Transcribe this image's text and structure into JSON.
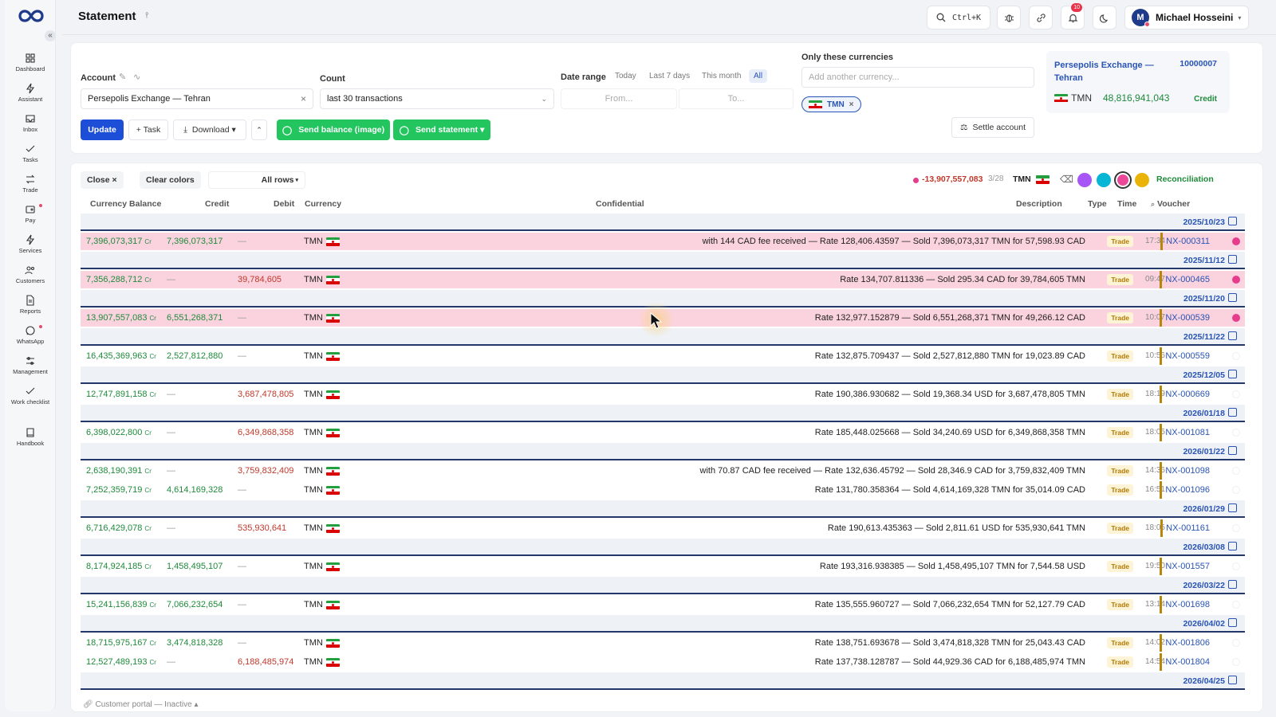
{
  "app": {
    "title": "Statement"
  },
  "sidebar": {
    "items": [
      {
        "label": "Dashboard",
        "icon": "grid-icon"
      },
      {
        "label": "Assistant",
        "icon": "bolt-icon"
      },
      {
        "label": "Inbox",
        "icon": "inbox-icon"
      },
      {
        "label": "Tasks",
        "icon": "check-icon"
      },
      {
        "label": "Trade",
        "icon": "swap-icon"
      },
      {
        "label": "Pay",
        "icon": "wallet-icon"
      },
      {
        "label": "Services",
        "icon": "bolt-icon"
      },
      {
        "label": "Customers",
        "icon": "users-icon"
      },
      {
        "label": "Reports",
        "icon": "file-icon"
      },
      {
        "label": "WhatsApp",
        "icon": "chat-icon"
      },
      {
        "label": "Management",
        "icon": "sliders-icon"
      },
      {
        "label": "Work checklist",
        "icon": "check-icon"
      },
      {
        "label": "Handbook",
        "icon": "book-icon"
      }
    ]
  },
  "header": {
    "search_shortcut": "Ctrl+K",
    "notification_count": "10",
    "user_initial": "M",
    "user_name": "Michael Hosseini"
  },
  "filters": {
    "account_label": "Account",
    "account_value": "Persepolis Exchange — Tehran",
    "count_label": "Count",
    "count_value": "last 30 transactions",
    "date_range_label": "Date range",
    "date_chips": [
      "Today",
      "Last 7 days",
      "This month",
      "All"
    ],
    "from_placeholder": "From...",
    "to_placeholder": "To...",
    "currencies_label": "Only these currencies",
    "currency_placeholder": "Add another currency...",
    "selected_currency": "TMN",
    "buttons": {
      "update": "Update",
      "task": "+ Task",
      "download": "Download ▾",
      "send_balance": "Send balance (image)",
      "send_statement": "Send statement ▾",
      "settle": "Settle account"
    }
  },
  "account_card": {
    "name_line1": "Persepolis Exchange —",
    "name_line2": "Tehran",
    "id": "10000007",
    "currency": "TMN",
    "balance": "48,816,941,043",
    "status": "Credit"
  },
  "table": {
    "toolbar": {
      "close": "Close ×",
      "clear_colors": "Clear colors",
      "rows_select": "All rows",
      "summary_value": "-13,907,557,083",
      "summary_count": "3/28",
      "summary_currency": "TMN",
      "reconciliation": "Reconciliation"
    },
    "colors": [
      "#a855f7",
      "#06b6d4",
      "#ec4899",
      "#eab308"
    ],
    "columns": {
      "balance": "Currency Balance",
      "credit": "Credit",
      "debit": "Debit",
      "currency": "Currency",
      "confidential": "Confidential",
      "description": "Description",
      "type": "Type",
      "time": "Time",
      "voucher": "Voucher"
    },
    "rows": [
      {
        "date": "2025/10/23",
        "balance": "7,396,073,317",
        "credit": "7,396,073,317",
        "debit": "—",
        "currency": "TMN",
        "desc": "with 144 CAD fee received — Rate 128,406.43597 — Sold 7,396,073,317 TMN for 57,598.93 CAD",
        "type": "Trade",
        "time": "17:34",
        "voucher": "NX-000311",
        "hl": true
      },
      {
        "date": "2025/11/12",
        "balance": "7,356,288,712",
        "credit": "—",
        "debit": "39,784,605",
        "currency": "TMN",
        "desc": "Rate 134,707.811336 — Sold 295.34 CAD for 39,784,605 TMN",
        "type": "Trade",
        "time": "09:47",
        "voucher": "NX-000465",
        "hl": true
      },
      {
        "date": "2025/11/20",
        "balance": "13,907,557,083",
        "credit": "6,551,268,371",
        "debit": "—",
        "currency": "TMN",
        "desc": "Rate 132,977.152879 — Sold 6,551,268,371 TMN for 49,266.12 CAD",
        "type": "Trade",
        "time": "10:07",
        "voucher": "NX-000539",
        "hl": true
      },
      {
        "date": "2025/11/22",
        "balance": "16,435,369,963",
        "credit": "2,527,812,880",
        "debit": "—",
        "currency": "TMN",
        "desc": "Rate 132,875.709437 — Sold 2,527,812,880 TMN for 19,023.89 CAD",
        "type": "Trade",
        "time": "10:56",
        "voucher": "NX-000559",
        "hl": false
      },
      {
        "date": "2025/12/05",
        "balance": "12,747,891,158",
        "credit": "—",
        "debit": "3,687,478,805",
        "currency": "TMN",
        "desc": "Rate 190,386.930682 — Sold 19,368.34 USD for 3,687,478,805 TMN",
        "type": "Trade",
        "time": "18:19",
        "voucher": "NX-000669",
        "hl": false
      },
      {
        "date": "2026/01/18",
        "balance": "6,398,022,800",
        "credit": "—",
        "debit": "6,349,868,358",
        "currency": "TMN",
        "desc": "Rate 185,448.025668 — Sold 34,240.69 USD for 6,349,868,358 TMN",
        "type": "Trade",
        "time": "18:05",
        "voucher": "NX-001081",
        "hl": false
      },
      {
        "date": "2026/01/22",
        "balance": "2,638,190,391",
        "credit": "—",
        "debit": "3,759,832,409",
        "currency": "TMN",
        "desc": "with 70.87 CAD fee received — Rate 132,636.45792 — Sold 28,346.9 CAD for 3,759,832,409 TMN",
        "type": "Trade",
        "time": "14:36",
        "voucher": "NX-001098",
        "hl": false
      },
      {
        "date": "",
        "balance": "7,252,359,719",
        "credit": "4,614,169,328",
        "debit": "—",
        "currency": "TMN",
        "desc": "Rate 131,780.358364 — Sold 4,614,169,328 TMN for 35,014.09 CAD",
        "type": "Trade",
        "time": "16:51",
        "voucher": "NX-001096",
        "hl": false
      },
      {
        "date": "2026/01/29",
        "balance": "6,716,429,078",
        "credit": "—",
        "debit": "535,930,641",
        "currency": "TMN",
        "desc": "Rate 190,613.435363 — Sold 2,811.61 USD for 535,930,641 TMN",
        "type": "Trade",
        "time": "18:05",
        "voucher": "NX-001161",
        "hl": false
      },
      {
        "date": "2026/03/08",
        "balance": "8,174,924,185",
        "credit": "1,458,495,107",
        "debit": "—",
        "currency": "TMN",
        "desc": "Rate 193,316.938385 — Sold 1,458,495,107 TMN for 7,544.58 USD",
        "type": "Trade",
        "time": "19:50",
        "voucher": "NX-001557",
        "hl": false
      },
      {
        "date": "2026/03/22",
        "balance": "15,241,156,839",
        "credit": "7,066,232,654",
        "debit": "—",
        "currency": "TMN",
        "desc": "Rate 135,555.960727 — Sold 7,066,232,654 TMN for 52,127.79 CAD",
        "type": "Trade",
        "time": "13:14",
        "voucher": "NX-001698",
        "hl": false
      },
      {
        "date": "2026/04/02",
        "balance": "18,715,975,167",
        "credit": "3,474,818,328",
        "debit": "—",
        "currency": "TMN",
        "desc": "Rate 138,751.693678 — Sold 3,474,818,328 TMN for 25,043.43 CAD",
        "type": "Trade",
        "time": "14:02",
        "voucher": "NX-001806",
        "hl": false
      },
      {
        "date": "",
        "balance": "12,527,489,193",
        "credit": "—",
        "debit": "6,188,485,974",
        "currency": "TMN",
        "desc": "Rate 137,738.128787 — Sold 44,929.36 CAD for 6,188,485,974 TMN",
        "type": "Trade",
        "time": "14:54",
        "voucher": "NX-001804",
        "hl": false
      }
    ],
    "last_date": "2026/04/25",
    "balance_suffix": "Cr"
  },
  "footer": {
    "portal": "Customer portal — Inactive"
  }
}
